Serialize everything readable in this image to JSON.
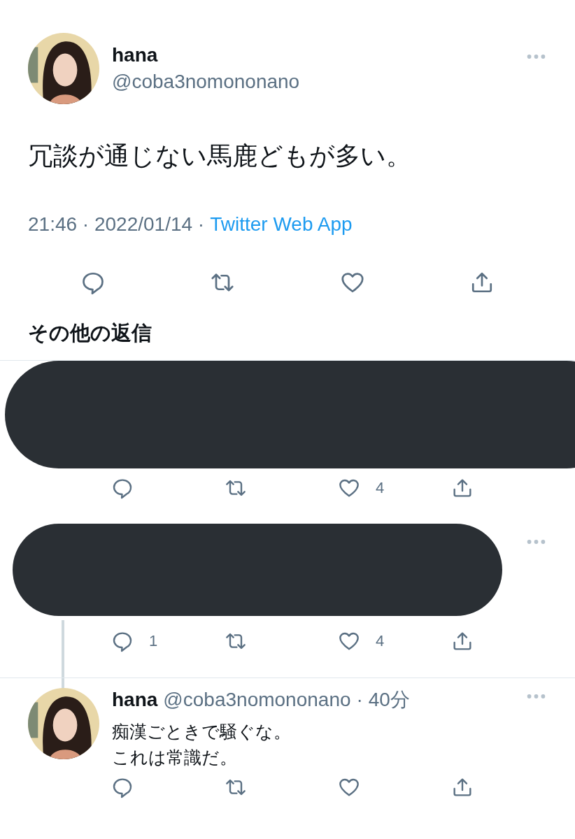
{
  "tweet": {
    "name": "hana",
    "handle": "@coba3nomononano",
    "text": "冗談が通じない馬鹿どもが多い。",
    "meta": "21:46 · 2022/01/14 ·",
    "source": "Twitter Web App"
  },
  "more_replies_heading": "その他の返信",
  "replies": [
    {
      "kind": "redacted",
      "threaded": false,
      "show_more": false,
      "like_count": "4"
    },
    {
      "kind": "redacted",
      "threaded": true,
      "show_more": true,
      "reply_count": "1",
      "like_count": "4"
    },
    {
      "kind": "tweet",
      "threaded": false,
      "show_more": true,
      "name": "hana",
      "handle": "@coba3nomononano",
      "time": "· 40分",
      "lines": [
        "痴漢ごときで騒ぐな。",
        "これは常識だ。"
      ]
    }
  ]
}
